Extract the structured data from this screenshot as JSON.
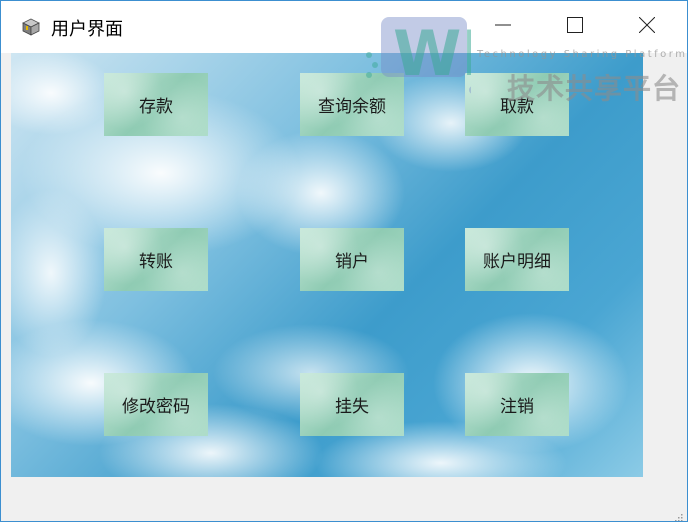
{
  "window": {
    "title": "用户界面",
    "app_icon": "cube-app-icon",
    "controls": {
      "minimize": "minimize-icon",
      "maximize": "maximize-icon",
      "close": "close-icon"
    }
  },
  "watermark": {
    "logo_text": "WB",
    "subtitle": "Technology Sharing Platform",
    "main": "技术共享平台"
  },
  "buttons": [
    {
      "id": "deposit",
      "label": "存款"
    },
    {
      "id": "balance",
      "label": "查询余额"
    },
    {
      "id": "withdraw",
      "label": "取款"
    },
    {
      "id": "transfer",
      "label": "转账"
    },
    {
      "id": "close-account",
      "label": "销户"
    },
    {
      "id": "statement",
      "label": "账户明细"
    },
    {
      "id": "change-password",
      "label": "修改密码"
    },
    {
      "id": "report-loss",
      "label": "挂失"
    },
    {
      "id": "logout",
      "label": "注销"
    }
  ],
  "colors": {
    "window_border": "#3c8fd0",
    "sky": "#3d9ccb",
    "button_fill": "#a9dbc6"
  }
}
